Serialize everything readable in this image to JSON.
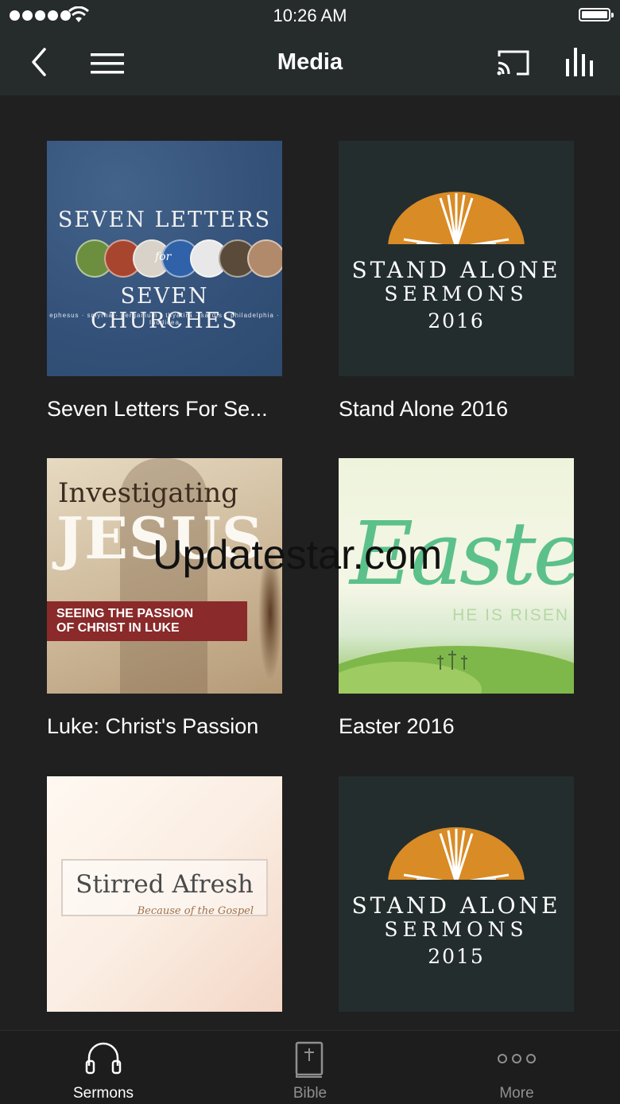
{
  "status_bar": {
    "time": "10:26 AM"
  },
  "nav": {
    "title": "Media",
    "back_icon": "chevron-left-icon",
    "menu_icon": "hamburger-menu-icon",
    "cast_icon": "cast-icon",
    "stats_icon": "bar-chart-icon"
  },
  "media": [
    {
      "caption": "Seven Letters For Se...",
      "art": {
        "line1": "SEVEN LETTERS",
        "for": "for",
        "line2": "SEVEN CHURCHES",
        "cities": "ephesus · smyrna · pergamum · thyatira · sardis · philadelphia · laodicea"
      }
    },
    {
      "caption": "Stand Alone 2016",
      "art": {
        "line1": "STAND ALONE",
        "line2": "SERMONS",
        "line3": "2016"
      }
    },
    {
      "caption": "Luke: Christ's Passion",
      "art": {
        "line1": "Investigating",
        "line2": "JESUS",
        "banner1": "SEEING THE PASSION",
        "banner2": "OF CHRIST IN LUKE"
      }
    },
    {
      "caption": "Easter 2016",
      "art": {
        "word": "Easter",
        "tagline": "HE IS RISEN"
      }
    },
    {
      "caption": "",
      "art": {
        "title": "Stirred Afresh",
        "subtitle": "Because of the Gospel"
      }
    },
    {
      "caption": "",
      "art": {
        "line1": "STAND ALONE",
        "line2": "SERMONS",
        "line3": "2015"
      }
    }
  ],
  "watermark": "Updatestar.com",
  "tabs": [
    {
      "label": "Sermons",
      "icon": "headphones-icon",
      "active": true
    },
    {
      "label": "Bible",
      "icon": "bible-icon",
      "active": false
    },
    {
      "label": "More",
      "icon": "more-dots-icon",
      "active": false
    }
  ],
  "colors": {
    "background": "#202020",
    "bar": "#262b2c",
    "accent_sun": "#d98b26"
  }
}
